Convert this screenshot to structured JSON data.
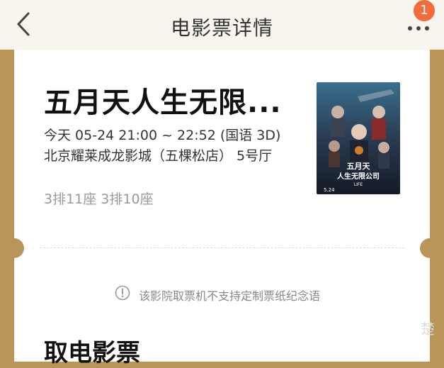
{
  "nav": {
    "title": "电影票详情",
    "back_icon": "chevron-left-icon",
    "more_icon": "more-horizontal-icon",
    "badge_count": "1"
  },
  "ticket": {
    "movie_title": "五月天人生无限...",
    "showtime": "今天 05-24 21:00 ~ 22:52 (国语 3D)",
    "cinema": "北京耀莱成龙影城（五棵松店） 5号厅",
    "seats": "3排11座 3排10座",
    "poster": {
      "title_line1": "五月天",
      "title_line2": "人生无限公司",
      "subtitle": "LIFE",
      "date": "5.24"
    },
    "notice_icon": "info-circle-icon",
    "notice": "该影院取票机不支持定制票纸纪念语"
  },
  "section": {
    "title": "取电影票"
  },
  "watermark": "楚",
  "colors": {
    "accent": "#b9955a",
    "badge": "#f26b3a",
    "nav_bg": "#f8f5ef"
  }
}
